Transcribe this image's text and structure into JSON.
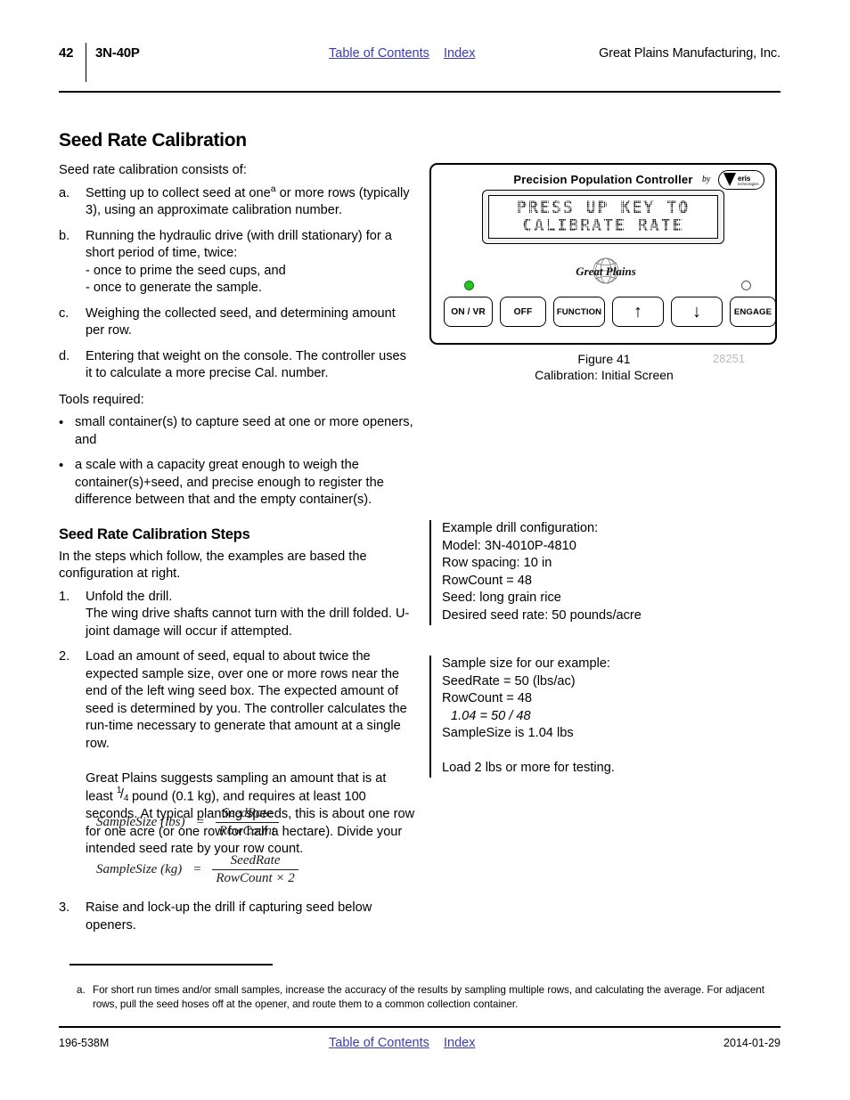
{
  "header": {
    "page_number": "42",
    "model": "3N-40P",
    "toc_link": "Table of Contents",
    "index_link": "Index",
    "company": "Great Plains Manufacturing, Inc."
  },
  "left_column": {
    "section_title": "Seed Rate Calibration",
    "intro": "Seed rate calibration consists of:",
    "lettered_steps": [
      {
        "mark": "a.",
        "text_before_sup": "Setting up to collect seed at one",
        "sup": "a",
        "text_after_sup": " or more rows (typically 3), using an approximate calibration number."
      },
      {
        "mark": "b.",
        "text": "Running the hydraulic drive (with drill stationary) for a short period of time, twice:",
        "sub_lines": [
          "- once to prime the seed cups, and",
          "- once to generate the sample."
        ]
      },
      {
        "mark": "c.",
        "text": "Weighing the collected seed, and determining amount per row."
      },
      {
        "mark": "d.",
        "text": "Entering that weight on the console. The controller uses it to calculate a more precise Cal. number."
      }
    ],
    "tools_heading": "Tools required:",
    "tools": [
      {
        "mark": "•",
        "text": "small container(s) to capture seed at one or more openers, and"
      },
      {
        "mark": "•",
        "text": "a scale with a capacity great enough to weigh the container(s)+seed, and precise enough to register the difference between that and the empty container(s)."
      }
    ],
    "steps_title": "Seed Rate Calibration Steps",
    "steps_intro": "In the steps which follow, the examples are based the configuration at right.",
    "numbered_steps": [
      {
        "mark": "1.",
        "lines": [
          "Unfold the drill.",
          "The wing drive shafts cannot turn with the drill folded. U-joint damage will occur if attempted."
        ]
      },
      {
        "mark": "2.",
        "para1": "Load an amount of seed, equal to about twice the expected sample size, over one or more rows near the end of the left wing seed box. The expected amount of seed is determined by you. The controller calculates the run-time necessary to generate that amount at a single row.",
        "para2_before_frac": "Great Plains suggests sampling an amount that is at least ",
        "frac_num": "1",
        "frac_slash": "/",
        "frac_den": "4",
        "para2_after_frac": " pound (0.1 kg), and requires at least 100 seconds. At typical planting speeds, this is about one row for one acre (or one row for half a hectare). Divide your intended seed rate by your row count."
      },
      {
        "mark": "3.",
        "lines": [
          "Raise and lock-up the drill if capturing seed below openers."
        ]
      }
    ]
  },
  "equations": [
    {
      "lhs": "SampleSize (lbs)",
      "operator": "=",
      "numerator": "SeedRate",
      "denominator": "RowCount"
    },
    {
      "lhs": "SampleSize (kg)",
      "operator": "=",
      "numerator": "SeedRate",
      "denominator": "RowCount × 2"
    }
  ],
  "figure": {
    "controller_title": "Precision Population Controller",
    "brand_by": "by",
    "brand_name": "eris",
    "brand_tagline": "technologies",
    "lcd_line1": "PRESS UP KEY TO",
    "lcd_line2": "CALIBRATE RATE",
    "gp_logo_text": "Great Plains",
    "buttons": [
      {
        "id": "on-vr",
        "label": "ON / VR"
      },
      {
        "id": "off",
        "label": "OFF"
      },
      {
        "id": "function",
        "label": "FUNCTION"
      },
      {
        "id": "up",
        "label": "↑"
      },
      {
        "id": "down",
        "label": "↓"
      },
      {
        "id": "engage",
        "label": "ENGAGE"
      }
    ],
    "led_on_color": "#22c522",
    "led_off_color": "#ffffff",
    "caption_number": "Figure 41",
    "caption_text": "Calibration: Initial Screen",
    "figure_id": "28251"
  },
  "example_config": {
    "lines": [
      "Example drill configuration:",
      "Model: 3N-4010P-4810",
      "Row spacing: 10 in",
      "RowCount = 48",
      "Seed: long grain rice",
      "Desired seed rate: 50 pounds/acre"
    ]
  },
  "example_sample": {
    "line1": "Sample size for our example:",
    "line2": "SeedRate = 50 (lbs/ac)",
    "line3": "RowCount = 48",
    "line4_italic": "1.04 = 50 / 48",
    "line5": "SampleSize is 1.04 lbs",
    "line6": "Load 2 lbs or more for testing."
  },
  "footnote": {
    "mark": "a.",
    "text": "For short run times and/or small samples, increase the accuracy of the results by sampling multiple rows, and calculating the average. For adjacent rows, pull the seed hoses off at the opener, and route them to a common collection container."
  },
  "footer": {
    "doc_number": "196-538M",
    "toc_link": "Table of Contents",
    "index_link": "Index",
    "date": "2014-01-29"
  },
  "colors": {
    "link": "#3b3bbb",
    "led_green": "#22c522",
    "figure_id_gray": "#b9b9b9"
  }
}
